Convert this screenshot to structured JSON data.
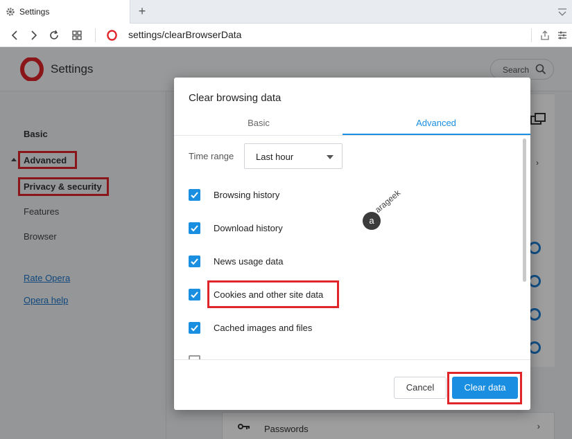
{
  "browser": {
    "tab_title": "Settings",
    "new_tab_symbol": "+",
    "url": "settings/clearBrowserData"
  },
  "settings_page": {
    "title": "Settings",
    "search_label": "Search",
    "sidebar": {
      "basic": "Basic",
      "advanced": "Advanced",
      "privacy_security": "Privacy & security",
      "features": "Features",
      "browser": "Browser",
      "rate_opera": "Rate Opera",
      "opera_help": "Opera help"
    },
    "passwords_label": "Passwords"
  },
  "dialog": {
    "title": "Clear browsing data",
    "tabs": [
      "Basic",
      "Advanced"
    ],
    "active_tab": "Advanced",
    "time_range_label": "Time range",
    "time_range_value": "Last hour",
    "options": [
      {
        "label": "Browsing history",
        "checked": true
      },
      {
        "label": "Download history",
        "checked": true
      },
      {
        "label": "News usage data",
        "checked": true
      },
      {
        "label": "Cookies and other site data",
        "checked": true
      },
      {
        "label": "Cached images and files",
        "checked": true
      }
    ],
    "cancel_label": "Cancel",
    "clear_label": "Clear data"
  },
  "watermark": {
    "logo_letter": "a",
    "text": "arageek"
  },
  "colors": {
    "accent": "#1a8ee0",
    "highlight_box": "#e0252a",
    "opera_red": "#e0252a"
  }
}
